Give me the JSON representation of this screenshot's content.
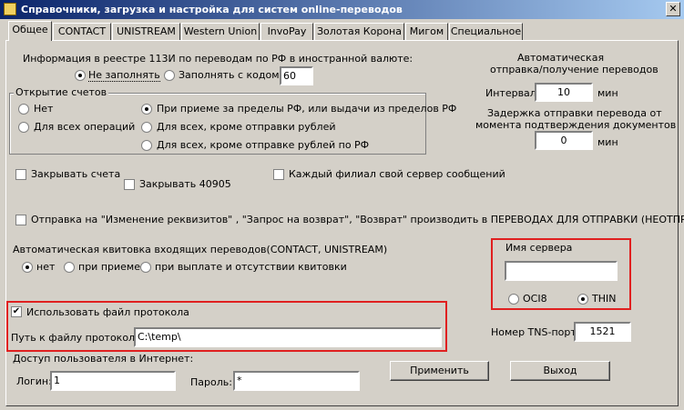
{
  "window": {
    "title": "Справочники, загрузка и настройка для систем online-переводов",
    "close_glyph": "✕"
  },
  "tabs": [
    {
      "label": "Общее"
    },
    {
      "label": "CONTACT"
    },
    {
      "label": "UNISTREAM"
    },
    {
      "label": "Western Union"
    },
    {
      "label": "InvoPay"
    },
    {
      "label": "Золотая Корона"
    },
    {
      "label": "Мигом"
    },
    {
      "label": "Специальное"
    }
  ],
  "registry": {
    "label": "Информация в реестре 113И по переводам по РФ в иностранной валюте:",
    "no_fill_label": "Не заполнять",
    "no_fill_selected": true,
    "fill_code_label": "Заполнять с кодом",
    "fill_code_selected": false,
    "code_value": "60"
  },
  "account_opening": {
    "group_label": "Открытие счетов",
    "options": [
      {
        "label": "Нет",
        "selected": false
      },
      {
        "label": "Для всех операций",
        "selected": false
      },
      {
        "label": "При приеме за пределы РФ, или выдачи из пределов РФ",
        "selected": true
      },
      {
        "label": "Для всех, кроме отправки рублей",
        "selected": false
      },
      {
        "label": "Для всех, кроме отправке рублей по РФ",
        "selected": false
      }
    ]
  },
  "auto_exchange": {
    "title_line1": "Автоматическая",
    "title_line2": "отправка/получение переводов",
    "interval_label": "Интервал",
    "interval_value": "10",
    "interval_unit": "мин",
    "delay_line1": "Задержка отправки перевода от",
    "delay_line2": "момента подтверждения документов",
    "delay_value": "0",
    "delay_unit": "мин"
  },
  "checkboxes": {
    "close_accounts": {
      "label": "Закрывать счета",
      "checked": false
    },
    "close_40905": {
      "label": "Закрывать 40905",
      "checked": false
    },
    "branch_server": {
      "label": "Каждый филиал свой сервер сообщений",
      "checked": false
    },
    "change_details": {
      "label": "Отправка на \"Изменение реквизитов\" , \"Запрос на возврат\", \"Возврат\" производить в ПЕРЕВОДАХ ДЛЯ ОТПРАВКИ (НЕОТПРАВ.)",
      "checked": false
    }
  },
  "auto_receipt": {
    "label": "Автоматическая квитовка входящих переводов(CONTACT, UNISTREAM)",
    "options": [
      {
        "label": "нет",
        "selected": true
      },
      {
        "label": "при приеме",
        "selected": false
      },
      {
        "label": "при выплате и отсутствии квитовки",
        "selected": false
      }
    ]
  },
  "server": {
    "label": "Имя сервера",
    "value": "",
    "oci8_label": "OCI8",
    "oci8_selected": false,
    "thin_label": "THIN",
    "thin_selected": true,
    "tns_port_label": "Номер TNS-порта",
    "tns_port_value": "1521"
  },
  "protocol": {
    "use_label": "Использовать файл протокола",
    "use_checked": true,
    "check_glyph": "✔",
    "path_label": "Путь к файлу протокола",
    "path_value": "C:\\temp\\"
  },
  "internet_access": {
    "label": "Доступ пользователя в Интернет:",
    "login_label": "Логин:",
    "login_value": "1",
    "password_label": "Пароль:",
    "password_value": "*"
  },
  "buttons": {
    "apply": "Применить",
    "exit": "Выход"
  },
  "colors": {
    "highlight_frame": "#e02020",
    "title_bar": "#0a246a"
  }
}
